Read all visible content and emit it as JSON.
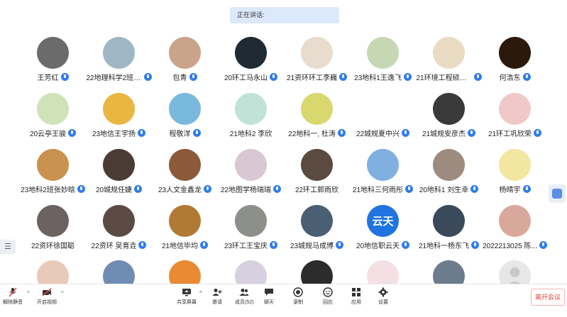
{
  "speaking": {
    "label": "正在讲话:"
  },
  "participants": [
    {
      "name": "王芳红",
      "mic": true,
      "color": "#6b6b6b"
    },
    {
      "name": "22地理科学2班刘倩睿",
      "mic": true,
      "color": "#9fb7c4"
    },
    {
      "name": "包青",
      "mic": true,
      "color": "#c9a48b"
    },
    {
      "name": "20环工马永山",
      "mic": true,
      "color": "#1f2a33"
    },
    {
      "name": "21资环环工李巍",
      "mic": true,
      "color": "#e7dccd"
    },
    {
      "name": "23地科1王逸飞",
      "mic": true,
      "color": "#c7d7b4"
    },
    {
      "name": "21环境工程硕士...",
      "mic": true,
      "color": "#e9dcc2"
    },
    {
      "name": "何浩东",
      "mic": true,
      "color": "#2b1a0c"
    },
    {
      "name": "20云亭王骏",
      "mic": true,
      "color": "#cfe2b8"
    },
    {
      "name": "23地信王宇扬",
      "mic": true,
      "color": "#e9b640"
    },
    {
      "name": "程敬洋",
      "mic": true,
      "color": "#7ab9de"
    },
    {
      "name": "21地科2 李欣",
      "mic": false,
      "color": "#bfe3d6"
    },
    {
      "name": "22地科一, 杜涛",
      "mic": true,
      "color": "#d8d86e"
    },
    {
      "name": "22城规夏中兴",
      "mic": true,
      "color": "#ffffff"
    },
    {
      "name": "21城规安彦杰",
      "mic": true,
      "color": "#3a3a3a"
    },
    {
      "name": "21环工巩欣荣",
      "mic": true,
      "color": "#f0c8c8"
    },
    {
      "name": "23地科2班张妙晗",
      "mic": true,
      "color": "#c9924f"
    },
    {
      "name": "20城规任婕",
      "mic": true,
      "color": "#4a3b35"
    },
    {
      "name": "23人文金鑫龙",
      "mic": true,
      "color": "#8a5a3a"
    },
    {
      "name": "22地图学杨瑞瑞",
      "mic": true,
      "color": "#d9c7d3"
    },
    {
      "name": "22环工郭雨欣",
      "mic": false,
      "color": "#5a4a40"
    },
    {
      "name": "21地科三何雨彤",
      "mic": true,
      "color": "#7fb0e0"
    },
    {
      "name": "20地科1 刘生幸",
      "mic": true,
      "color": "#9d8b80"
    },
    {
      "name": "杨晴宇",
      "mic": true,
      "color": "#f3e6a0"
    },
    {
      "name": "22资环徐国聪",
      "mic": false,
      "color": "#6d6262"
    },
    {
      "name": "22资环 吴育垚",
      "mic": true,
      "color": "#5b4a44"
    },
    {
      "name": "21地信毕均",
      "mic": true,
      "color": "#b07a35"
    },
    {
      "name": "23环工王宝庆",
      "mic": true,
      "color": "#8c8f8a"
    },
    {
      "name": "23城规马成博",
      "mic": true,
      "color": "#4b5f73"
    },
    {
      "name": "20地信职云天",
      "mic": true,
      "color": "#1f74e0",
      "initials": "云天"
    },
    {
      "name": "21地科一杨东飞",
      "mic": true,
      "color": "#3b4a5a"
    },
    {
      "name": "2022213025 陈...",
      "mic": true,
      "color": "#d9a89c"
    },
    {
      "name": "",
      "mic": false,
      "color": "#e9c9b9"
    },
    {
      "name": "",
      "mic": false,
      "color": "#6f8db3"
    },
    {
      "name": "",
      "mic": false,
      "color": "#e98a33"
    },
    {
      "name": "",
      "mic": false,
      "color": "#d6d0e0"
    },
    {
      "name": "",
      "mic": false,
      "color": "#2c2c2c"
    },
    {
      "name": "",
      "mic": false,
      "color": "#f3dfe4"
    },
    {
      "name": "",
      "mic": false,
      "color": "#6c7c8c"
    },
    {
      "name": "",
      "mic": false,
      "color": "#e7e7e7"
    }
  ],
  "toolbar": {
    "unmute": "解除静音",
    "video": "开启视频",
    "share": "共享屏幕",
    "invite": "邀请",
    "members": "成员(52)",
    "chat": "聊天",
    "record": "录制",
    "breakout": "回应",
    "apps": "应用",
    "settings": "设置",
    "leave": "离开会议"
  },
  "side": {
    "list_glyph": "☰"
  },
  "colors": {
    "accent": "#2f7cf0",
    "leave": "#e0443d",
    "banner": "#dce8fb"
  }
}
